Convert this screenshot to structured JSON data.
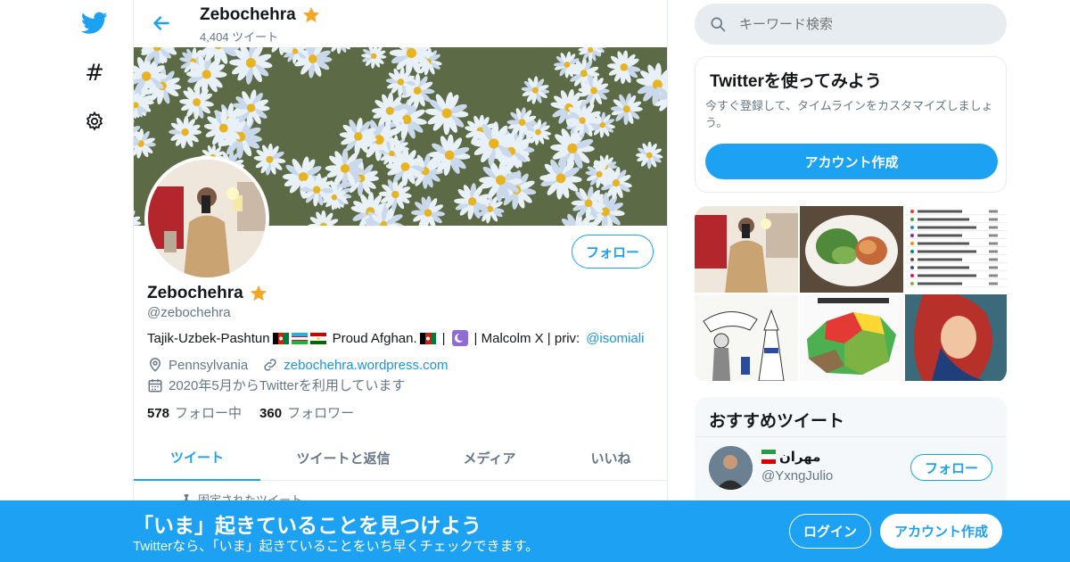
{
  "colors": {
    "accent": "#1da1f2",
    "link": "#1b95e0",
    "muted": "#657786",
    "text": "#14171a",
    "star": "#f5a623"
  },
  "nav": {
    "icons": [
      "twitter-bird-icon",
      "hashtag-icon",
      "settings-gear-icon"
    ]
  },
  "topbar": {
    "name": "Zebochehra",
    "tweet_count": "4,404 ツイート"
  },
  "profile": {
    "name": "Zebochehra",
    "handle": "@zebochehra",
    "follow_label": "フォロー",
    "bio_part1": "Tajik-Uzbek-Pashtun",
    "bio_part2": "Proud Afghan.",
    "bio_part3": "|",
    "bio_part4": "| Malcolm X | priv:",
    "bio_mention": "@isomiali",
    "location": "Pennsylvania",
    "website": "zebochehra.wordpress.com",
    "joined": "2020年5月からTwitterを利用しています",
    "following_count": "578",
    "following_label": "フォロー中",
    "followers_count": "360",
    "followers_label": "フォロワー"
  },
  "tabs": [
    "ツイート",
    "ツイートと返信",
    "メディア",
    "いいね"
  ],
  "pinned_label": "固定されたツイート",
  "search": {
    "placeholder": "キーワード検索"
  },
  "signup_card": {
    "title": "Twitterを使ってみよう",
    "description": "今すぐ登録して、タイムラインをカスタマイズしましょう。",
    "button": "アカウント作成"
  },
  "recommended": {
    "title": "おすすめツイート",
    "name": "مهران",
    "handle": "@YxngJulio",
    "follow_label": "フォロー"
  },
  "bottom_bar": {
    "headline": "「いま」起きていることを見つけよう",
    "subtext": "Twitterなら、「いま」起きていることをいち早くチェックできます。",
    "login": "ログイン",
    "signup": "アカウント作成"
  }
}
